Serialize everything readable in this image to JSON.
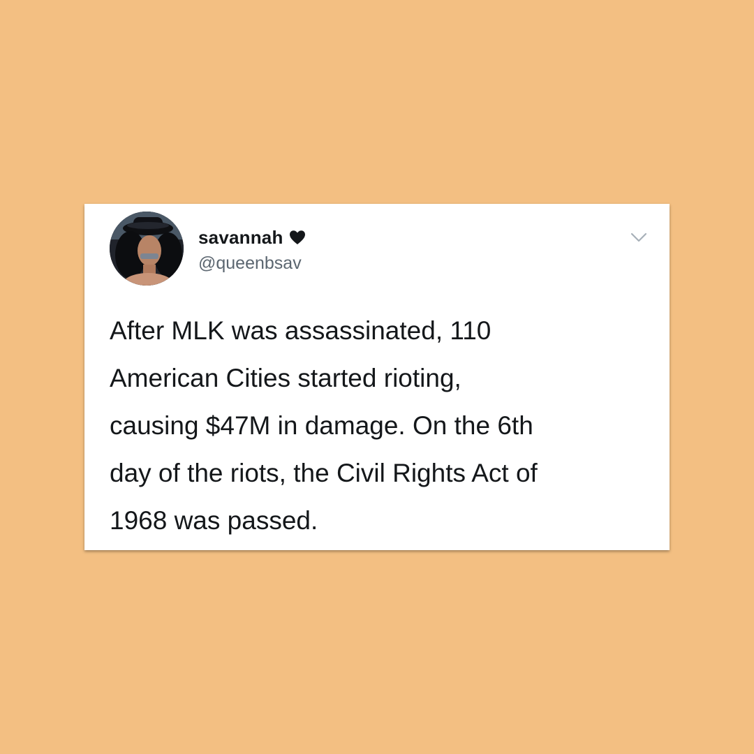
{
  "theme": {
    "background": "#f3bf82",
    "card_background": "#ffffff",
    "text_color": "#14171a",
    "handle_color": "#5b6670"
  },
  "tweet": {
    "user": {
      "display_name": "savannah",
      "name_icon": "heart-icon",
      "handle": "@queenbsav",
      "avatar": "profile-photo"
    },
    "menu_icon": "chevron-down-icon",
    "lines": [
      "After MLK was assassinated, 110",
      "American Cities started rioting,",
      "causing $47M in damage. On the 6th",
      "day of the riots, the Civil Rights Act of",
      "1968 was passed."
    ]
  }
}
